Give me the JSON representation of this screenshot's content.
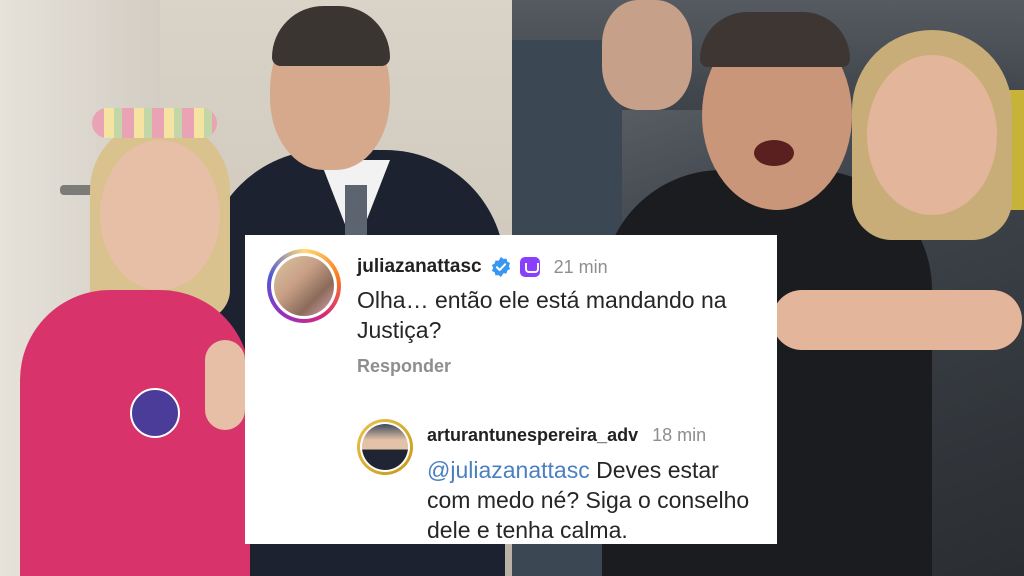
{
  "comment": {
    "username": "juliazanattasc",
    "time": "21 min",
    "text": "Olha… então ele está mandando na Justiça?",
    "reply_label": "Responder",
    "icons": [
      "verified-icon",
      "subscriber-badge-icon"
    ]
  },
  "reply": {
    "username": "arturantunespereira_adv",
    "time": "18 min",
    "mention": "@juliazanattasc",
    "text": " Deves estar com medo né? Siga o conselho dele e tenha calma."
  },
  "colors": {
    "card_background": "#ffffff",
    "username": "#222222",
    "meta_gray": "#8e8e8e",
    "mention_blue": "#4a7fc1",
    "verified_blue": "#3897f0",
    "subscriber_purple": "#8a3ffc"
  }
}
